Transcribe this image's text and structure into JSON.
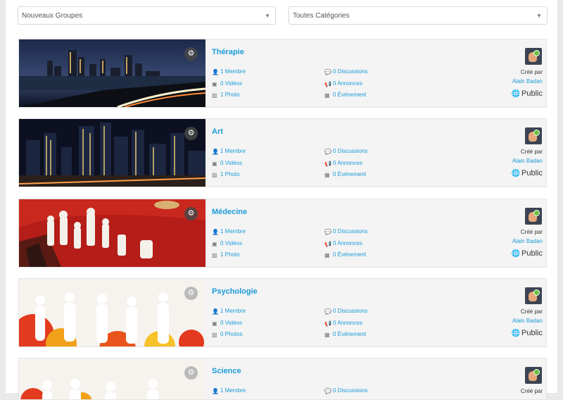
{
  "filters": {
    "left_label": "Nouveaux Groupes",
    "right_label": "Toutes Catégories"
  },
  "groups": [
    {
      "title": "Thérapie",
      "members": "1 Membre",
      "videos": "0 Vidéos",
      "photos": "1 Photo",
      "discussions": "0 Discussions",
      "announcements": "0 Annonces",
      "events": "0 Événement",
      "created_by": "Créé par",
      "author": "Alain Badan",
      "visibility": "Public"
    },
    {
      "title": "Art",
      "members": "1 Membre",
      "videos": "0 Vidéos",
      "photos": "1 Photo",
      "discussions": "0 Discussions",
      "announcements": "0 Annonces",
      "events": "0 Événement",
      "created_by": "Créé par",
      "author": "Alain Badan",
      "visibility": "Public"
    },
    {
      "title": "Médecine",
      "members": "1 Membre",
      "videos": "0 Vidéos",
      "photos": "1 Photo",
      "discussions": "0 Discussions",
      "announcements": "0 Annonces",
      "events": "0 Événement",
      "created_by": "Créé par",
      "author": "Alain Badan",
      "visibility": "Public"
    },
    {
      "title": "Psychologie",
      "members": "1 Membre",
      "videos": "0 Vidéos",
      "photos": "0 Photos",
      "discussions": "0 Discussions",
      "announcements": "0 Annonces",
      "events": "0 Événement",
      "created_by": "Créé par",
      "author": "Alain Badan",
      "visibility": "Public"
    },
    {
      "title": "Science",
      "members": "1 Membre",
      "videos": "",
      "photos": "",
      "discussions": "0 Discussions",
      "announcements": "",
      "events": "",
      "created_by": "Créé par",
      "author": "",
      "visibility": ""
    }
  ],
  "icons": {
    "settings": "gear-icon",
    "members": "members-icon",
    "videos": "video-icon",
    "photos": "photo-icon",
    "discussions": "discussion-icon",
    "announcements": "megaphone-icon",
    "events": "calendar-icon",
    "visibility": "globe-icon"
  },
  "colors": {
    "link": "#1a9bd7",
    "card_bg": "#f4f4f4",
    "online": "#6ac33b"
  }
}
